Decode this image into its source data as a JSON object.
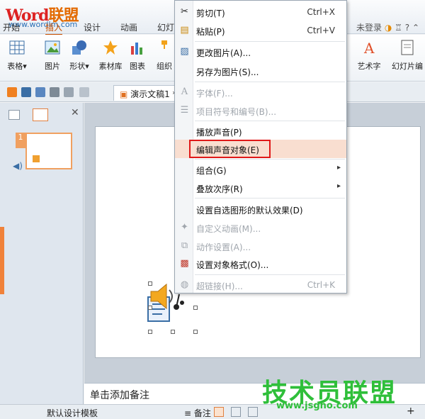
{
  "app": {
    "logo_word": "Word",
    "logo_lm": "联盟",
    "logo_url": "www.wordlm.com",
    "tabs": [
      "开始",
      "插入",
      "设计",
      "动画",
      "幻灯"
    ],
    "active_tab": "插入",
    "login": "未登录"
  },
  "ribbon": {
    "left_buttons": [
      "表格",
      "图片",
      "形状",
      "素材库",
      "图表",
      "组织"
    ],
    "right_buttons": [
      "艺术字",
      "幻灯片编"
    ]
  },
  "quickbar": {
    "doc_title": "演示文稿1 *"
  },
  "slide_panel": {
    "slide_number": "1"
  },
  "notes": {
    "placeholder": "单击添加备注"
  },
  "status": {
    "template": "默认设计模板",
    "notes_label": "备注"
  },
  "context_menu": {
    "items": [
      {
        "label": "剪切(T)",
        "shortcut": "Ctrl+X",
        "icon": "scissors-icon",
        "disabled": false
      },
      {
        "label": "粘贴(P)",
        "shortcut": "Ctrl+V",
        "icon": "paste-icon",
        "disabled": false
      },
      {
        "label": "更改图片(A)...",
        "shortcut": "",
        "icon": "change-picture-icon",
        "disabled": false
      },
      {
        "label": "另存为图片(S)...",
        "shortcut": "",
        "icon": "",
        "disabled": false
      },
      {
        "label": "字体(F)...",
        "shortcut": "",
        "icon": "font-icon",
        "disabled": true
      },
      {
        "label": "项目符号和编号(B)...",
        "shortcut": "",
        "icon": "bullets-icon",
        "disabled": true
      },
      {
        "label": "播放声音(P)",
        "shortcut": "",
        "icon": "",
        "disabled": false
      },
      {
        "label": "编辑声音对象(E)",
        "shortcut": "",
        "icon": "",
        "disabled": false,
        "highlighted": true
      },
      {
        "label": "组合(G)",
        "shortcut": "",
        "icon": "",
        "disabled": false,
        "submenu": true
      },
      {
        "label": "叠放次序(R)",
        "shortcut": "",
        "icon": "",
        "disabled": false,
        "submenu": true
      },
      {
        "label": "设置自选图形的默认效果(D)",
        "shortcut": "",
        "icon": "",
        "disabled": false
      },
      {
        "label": "自定义动画(M)...",
        "shortcut": "",
        "icon": "custom-animation-icon",
        "disabled": true
      },
      {
        "label": "动作设置(A)...",
        "shortcut": "",
        "icon": "action-settings-icon",
        "disabled": true
      },
      {
        "label": "设置对象格式(O)...",
        "shortcut": "",
        "icon": "format-object-icon",
        "disabled": false
      },
      {
        "label": "超链接(H)...",
        "shortcut": "Ctrl+K",
        "icon": "hyperlink-icon",
        "disabled": true
      }
    ]
  },
  "watermark": {
    "text": "技术员联盟",
    "url": "www.jsgho.com"
  },
  "colors": {
    "accent": "#c85000",
    "highlight_box": "#e01818",
    "watermark": "#2fbf3a"
  }
}
